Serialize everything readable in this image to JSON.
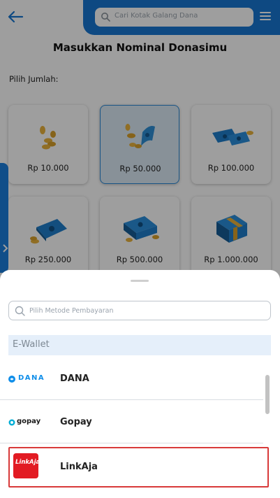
{
  "header": {
    "search_placeholder": "Cari Kotak Galang Dana",
    "icons": [
      "back-arrow-icon",
      "search-icon",
      "hamburger-menu-icon"
    ]
  },
  "page": {
    "title": "Masukkan Nominal Donasimu",
    "pick_label": "Pilih Jumlah:"
  },
  "amounts": [
    {
      "label": "Rp 10.000",
      "icon": "coins-icon",
      "selected": false
    },
    {
      "label": "Rp 50.000",
      "icon": "coins-bill-icon",
      "selected": true
    },
    {
      "label": "Rp 100.000",
      "icon": "banknotes-icon",
      "selected": false
    },
    {
      "label": "Rp 250.000",
      "icon": "bill-coins-icon",
      "selected": false
    },
    {
      "label": "Rp 500.000",
      "icon": "bill-stack-icon",
      "selected": false
    },
    {
      "label": "Rp 1.000.000",
      "icon": "money-bundle-icon",
      "selected": false
    }
  ],
  "sheet": {
    "search_placeholder": "Pilih Metode Pembayaran",
    "section_title": "E-Wallet",
    "methods": [
      {
        "name": "DANA",
        "logo_text": "DANA",
        "selected": false
      },
      {
        "name": "Gopay",
        "logo_text": "gopay",
        "selected": false
      },
      {
        "name": "LinkAja",
        "logo_text": "LinkAja!",
        "selected": true
      }
    ]
  },
  "colors": {
    "primary_blue": "#1877d2",
    "selected_card_bg": "#dbeaf6",
    "selected_border_red": "#d83a3a",
    "linkaja_red": "#e21b23",
    "dana_blue": "#108ee9",
    "coin_gold": "#e8b23c"
  }
}
